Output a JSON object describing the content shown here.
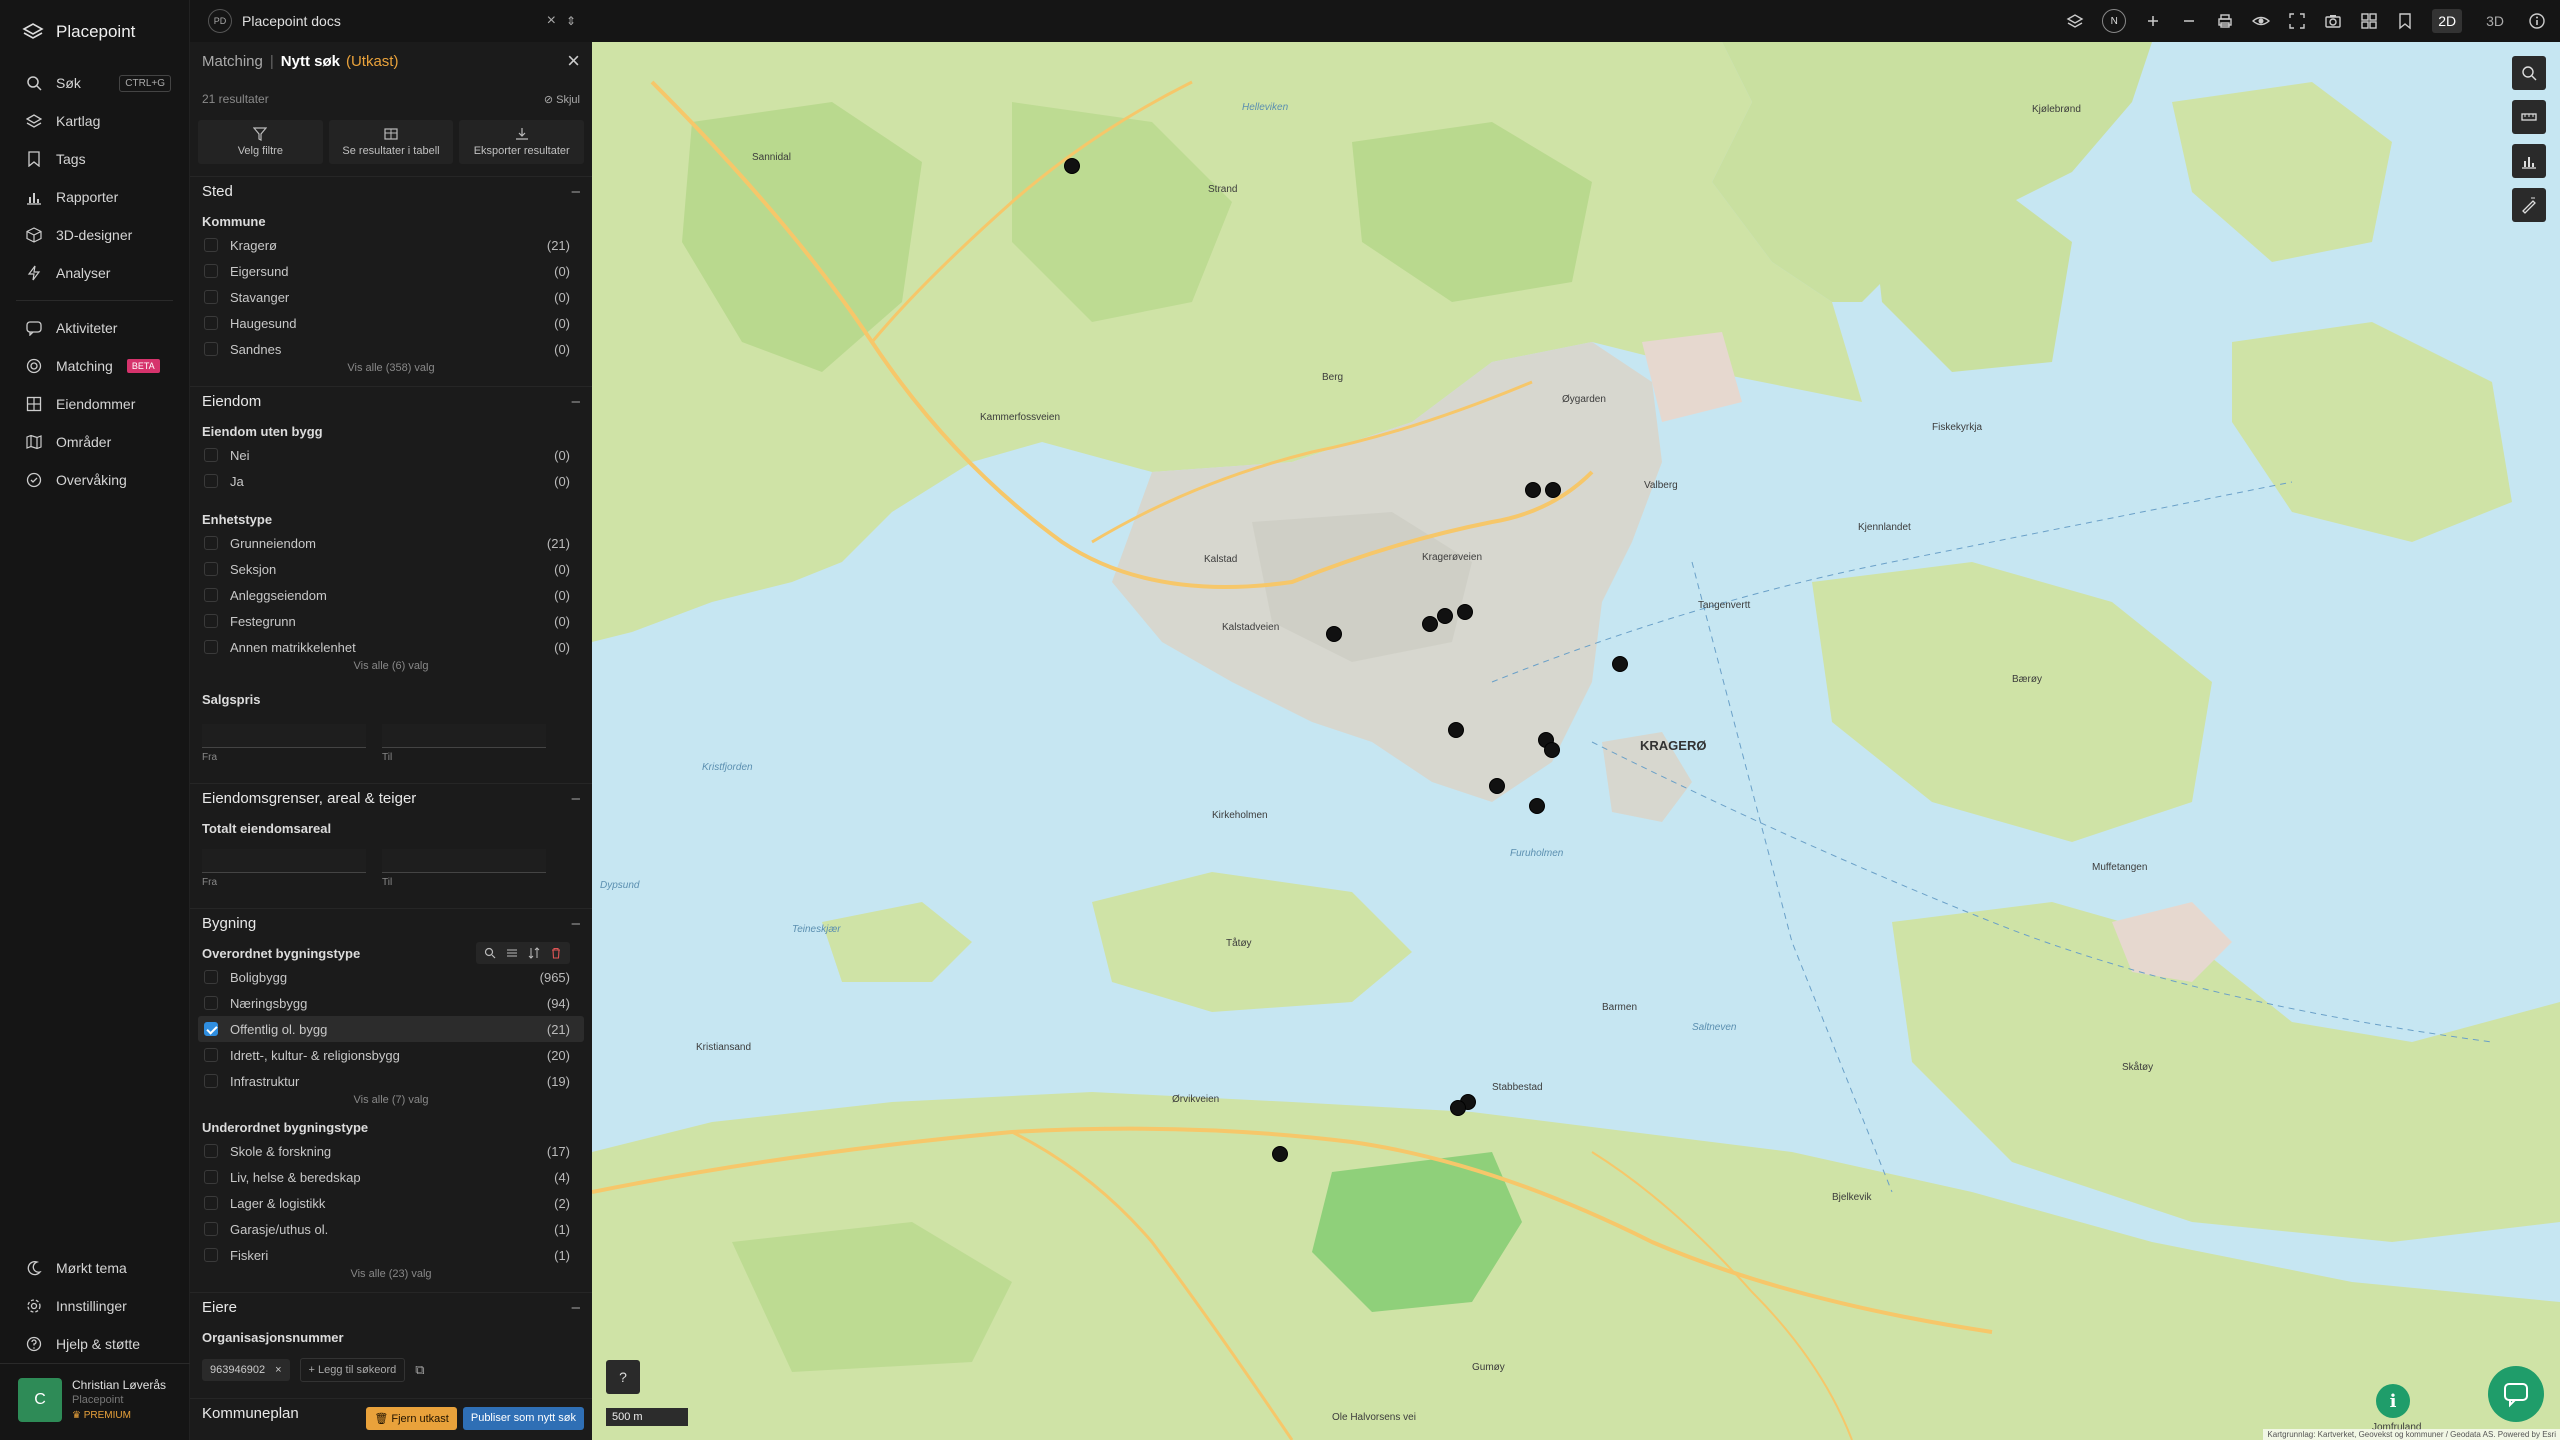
{
  "app": {
    "name": "Placepoint"
  },
  "nav": {
    "items": [
      {
        "label": "Søk",
        "icon": "search-icon",
        "shortcut": "CTRL+G"
      },
      {
        "label": "Kartlag",
        "icon": "layers-icon"
      },
      {
        "label": "Tags",
        "icon": "bookmark-icon"
      },
      {
        "label": "Rapporter",
        "icon": "bar-chart-icon"
      },
      {
        "label": "3D-designer",
        "icon": "cube-icon"
      },
      {
        "label": "Analyser",
        "icon": "bolt-icon"
      }
    ],
    "items2": [
      {
        "label": "Aktiviteter",
        "icon": "chat-icon"
      },
      {
        "label": "Matching",
        "icon": "target-icon",
        "badge": "BETA"
      },
      {
        "label": "Eiendommer",
        "icon": "grid-icon"
      },
      {
        "label": "Områder",
        "icon": "map-icon"
      },
      {
        "label": "Overvåking",
        "icon": "check-circle-icon"
      }
    ],
    "bottom": [
      {
        "label": "Mørkt tema",
        "icon": "moon-icon"
      },
      {
        "label": "Innstillinger",
        "icon": "gear-icon"
      },
      {
        "label": "Hjelp & støtte",
        "icon": "help-icon"
      }
    ],
    "user": {
      "initial": "C",
      "name": "Christian Løverås",
      "org": "Placepoint",
      "plan": "PREMIUM"
    }
  },
  "topbar": {
    "workspace_badge": "PD",
    "workspace": "Placepoint docs",
    "compass": "N",
    "mode_2d": "2D",
    "mode_3d": "3D"
  },
  "panel": {
    "crumb_root": "Matching",
    "crumb_current": "Nytt søk",
    "draft": "(Utkast)",
    "results": "21 resultater",
    "hide": "Skjul",
    "actions": [
      "Velg filtre",
      "Se resultater i tabell",
      "Eksporter resultater"
    ],
    "sted": {
      "title": "Sted",
      "kommune_label": "Kommune",
      "kommuner": [
        {
          "label": "Kragerø",
          "count": "(21)"
        },
        {
          "label": "Eigersund",
          "count": "(0)"
        },
        {
          "label": "Stavanger",
          "count": "(0)"
        },
        {
          "label": "Haugesund",
          "count": "(0)"
        },
        {
          "label": "Sandnes",
          "count": "(0)"
        }
      ],
      "show_all": "Vis alle (358) valg"
    },
    "eiendom": {
      "title": "Eiendom",
      "uten_bygg_label": "Eiendom uten bygg",
      "uten_bygg": [
        {
          "label": "Nei",
          "count": "(0)"
        },
        {
          "label": "Ja",
          "count": "(0)"
        }
      ],
      "enhetstype_label": "Enhetstype",
      "enhetstyper": [
        {
          "label": "Grunneiendom",
          "count": "(21)"
        },
        {
          "label": "Seksjon",
          "count": "(0)"
        },
        {
          "label": "Anleggseiendom",
          "count": "(0)"
        },
        {
          "label": "Festegrunn",
          "count": "(0)"
        },
        {
          "label": "Annen matrikkelenhet",
          "count": "(0)"
        }
      ],
      "enhet_show_all": "Vis alle (6) valg",
      "salgspris_label": "Salgspris",
      "from": "Fra",
      "to": "Til"
    },
    "grenser": {
      "title": "Eiendomsgrenser, areal & teiger",
      "areal_label": "Totalt eiendomsareal",
      "from": "Fra",
      "to": "Til"
    },
    "bygning": {
      "title": "Bygning",
      "overordnet_label": "Overordnet bygningstype",
      "overordnet": [
        {
          "label": "Boligbygg",
          "count": "(965)",
          "checked": false
        },
        {
          "label": "Næringsbygg",
          "count": "(94)",
          "checked": false
        },
        {
          "label": "Offentlig ol. bygg",
          "count": "(21)",
          "checked": true
        },
        {
          "label": "Idrett-, kultur- & religionsbygg",
          "count": "(20)",
          "checked": false
        },
        {
          "label": "Infrastruktur",
          "count": "(19)",
          "checked": false
        }
      ],
      "overordnet_show_all": "Vis alle (7) valg",
      "underordnet_label": "Underordnet bygningstype",
      "underordnet": [
        {
          "label": "Skole & forskning",
          "count": "(17)"
        },
        {
          "label": "Liv, helse & beredskap",
          "count": "(4)"
        },
        {
          "label": "Lager & logistikk",
          "count": "(2)"
        },
        {
          "label": "Garasje/uthus ol.",
          "count": "(1)"
        },
        {
          "label": "Fiskeri",
          "count": "(1)"
        }
      ],
      "underordnet_show_all": "Vis alle (23) valg"
    },
    "eiere": {
      "title": "Eiere",
      "org_label": "Organisasjonsnummer",
      "org_value": "963946902",
      "add_word": "+ Legg til søkeord"
    },
    "kommuneplan": {
      "title": "Kommuneplan"
    },
    "btn_remove": "Fjern utkast",
    "btn_publish": "Publiser som nytt søk"
  },
  "map": {
    "scale": "500 m",
    "help": "?",
    "info": "i",
    "attribution": "Kartgrunnlag: Kartverket, Geovekst og kommuner / Geodata AS. Powered by Esri",
    "places": [
      {
        "name": "KRAGERØ",
        "big": true
      },
      {
        "name": "Kragerøveien"
      },
      {
        "name": "Kalstadveien"
      },
      {
        "name": "Kammerfossveien"
      },
      {
        "name": "Ørvikveien"
      },
      {
        "name": "Ole Halvorsens vei"
      },
      {
        "name": "Kalstad"
      },
      {
        "name": "Stabbestad"
      },
      {
        "name": "Barmen"
      },
      {
        "name": "Kirkeholmen"
      },
      {
        "name": "Tåtøy"
      },
      {
        "name": "Gumøy"
      },
      {
        "name": "Skåtøy"
      },
      {
        "name": "Bærøy"
      },
      {
        "name": "Jomfruland"
      },
      {
        "name": "Kristiansand"
      },
      {
        "name": "Helleviken"
      },
      {
        "name": "Strand"
      },
      {
        "name": "Sannidal"
      },
      {
        "name": "Kjølebrønd"
      },
      {
        "name": "Bjelkevik"
      },
      {
        "name": "Øygarden"
      },
      {
        "name": "Valberg"
      },
      {
        "name": "Berg"
      },
      {
        "name": "Tangenvertt"
      },
      {
        "name": "Muffetangen"
      },
      {
        "name": "Kjennlandet"
      },
      {
        "name": "Fiskekyrkja"
      },
      {
        "name": "Furuholmen",
        "water": true
      },
      {
        "name": "Teineskjær",
        "water": true
      },
      {
        "name": "Kristfjorden",
        "water": true
      },
      {
        "name": "Dypsund",
        "water": true
      },
      {
        "name": "Saltneven",
        "water": true
      }
    ],
    "pins": 16
  }
}
